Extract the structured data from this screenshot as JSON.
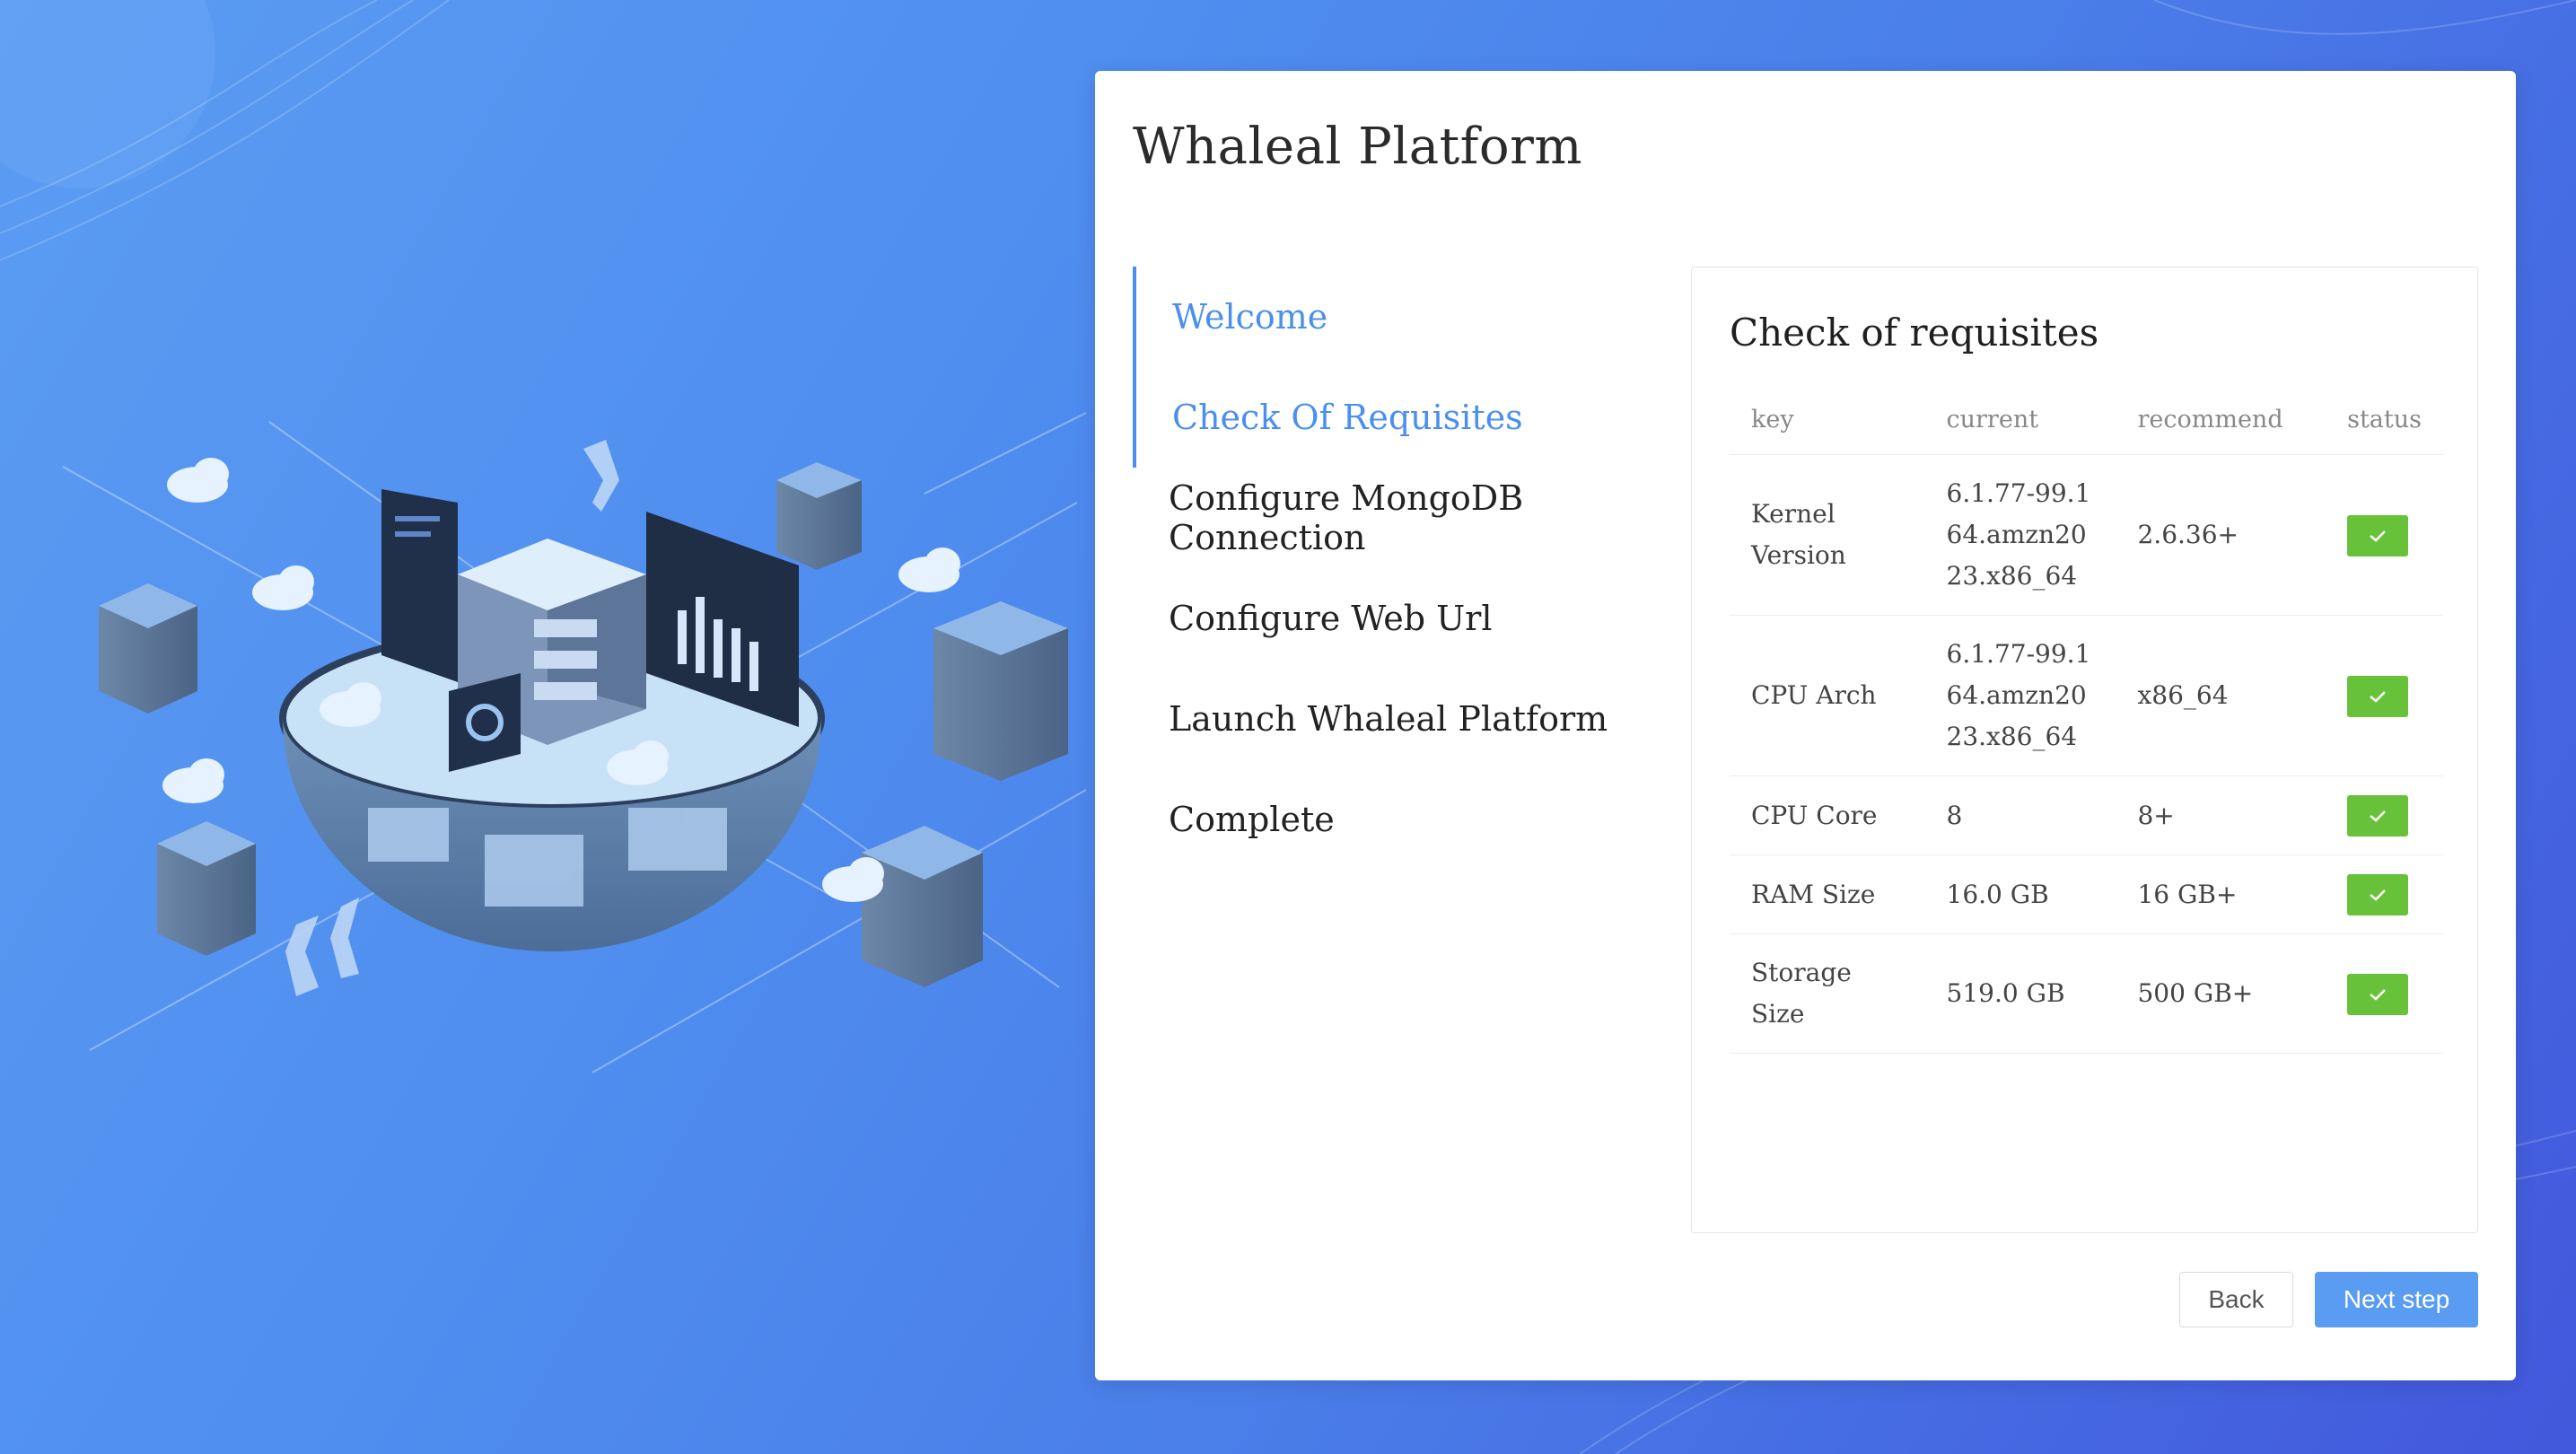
{
  "app": {
    "title": "Whaleal Platform"
  },
  "steps": [
    {
      "label": "Welcome",
      "state": "done"
    },
    {
      "label": "Check Of Requisites",
      "state": "active"
    },
    {
      "label": "Configure MongoDB Connection",
      "state": "pending"
    },
    {
      "label": "Configure Web Url",
      "state": "pending"
    },
    {
      "label": "Launch Whaleal Platform",
      "state": "pending"
    },
    {
      "label": "Complete",
      "state": "pending"
    }
  ],
  "requisites": {
    "title": "Check of requisites",
    "columns": [
      "key",
      "current",
      "recommend",
      "status"
    ],
    "rows": [
      {
        "key": "Kernel Version",
        "current": "6.1.77-99.164.amzn2023.x86_64",
        "recommend": "2.6.36+",
        "status": "ok"
      },
      {
        "key": "CPU Arch",
        "current": "6.1.77-99.164.amzn2023.x86_64",
        "recommend": "x86_64",
        "status": "ok"
      },
      {
        "key": "CPU Core",
        "current": "8",
        "recommend": "8+",
        "status": "ok"
      },
      {
        "key": "RAM Size",
        "current": "16.0 GB",
        "recommend": "16 GB+",
        "status": "ok"
      },
      {
        "key": "Storage Size",
        "current": "519.0 GB",
        "recommend": "500 GB+",
        "status": "ok"
      }
    ]
  },
  "buttons": {
    "back": "Back",
    "next": "Next step"
  },
  "colors": {
    "accent": "#4a8ff0",
    "success": "#67c23a",
    "background": "#4f8def"
  },
  "icons": {
    "status_ok": "check-icon"
  }
}
